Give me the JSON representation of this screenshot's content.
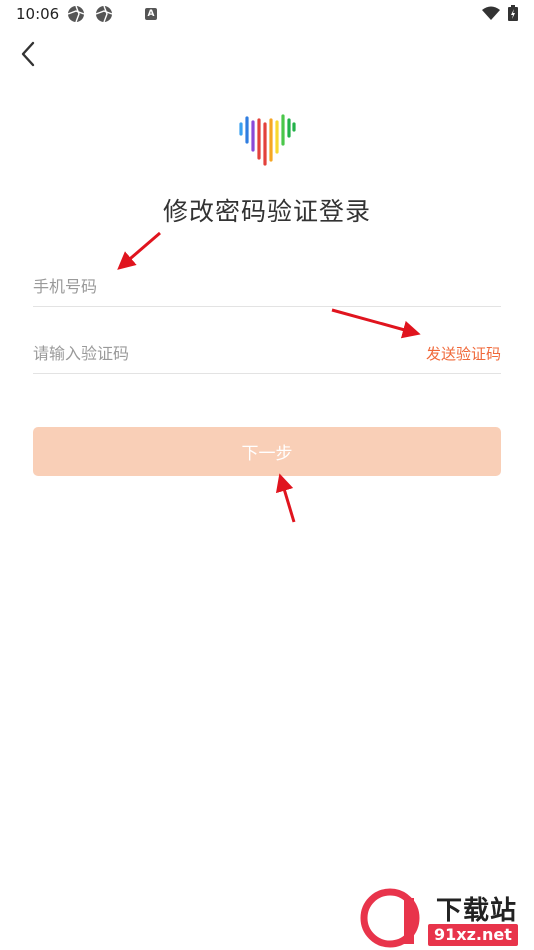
{
  "status_bar": {
    "time": "10:06",
    "left_icons": [
      "aperture-icon",
      "aperture-icon",
      "app-notification-icon"
    ],
    "app_notification_letter": "A",
    "right_icons": [
      "wifi-icon",
      "battery-charging-icon"
    ]
  },
  "header": {
    "back_icon": "chevron-left-icon"
  },
  "logo": {
    "icon": "heart-soundwave-logo",
    "colors": [
      "#3aa0f0",
      "#2f7de0",
      "#8a4ad8",
      "#e3413b",
      "#f5a623",
      "#f8d830",
      "#4bc74b",
      "#23b24a"
    ]
  },
  "title": "修改密码验证登录",
  "form": {
    "phone_placeholder": "手机号码",
    "phone_value": "",
    "code_placeholder": "请输入验证码",
    "code_value": "",
    "send_code_label": "发送验证码",
    "next_label": "下一步"
  },
  "colors": {
    "accent": "#f0693a",
    "button_bg": "#f9cfb7",
    "annotation_arrow": "#e0141e"
  },
  "watermark": {
    "logo_text": "9",
    "title": "下载站",
    "url": "91xz.net"
  }
}
